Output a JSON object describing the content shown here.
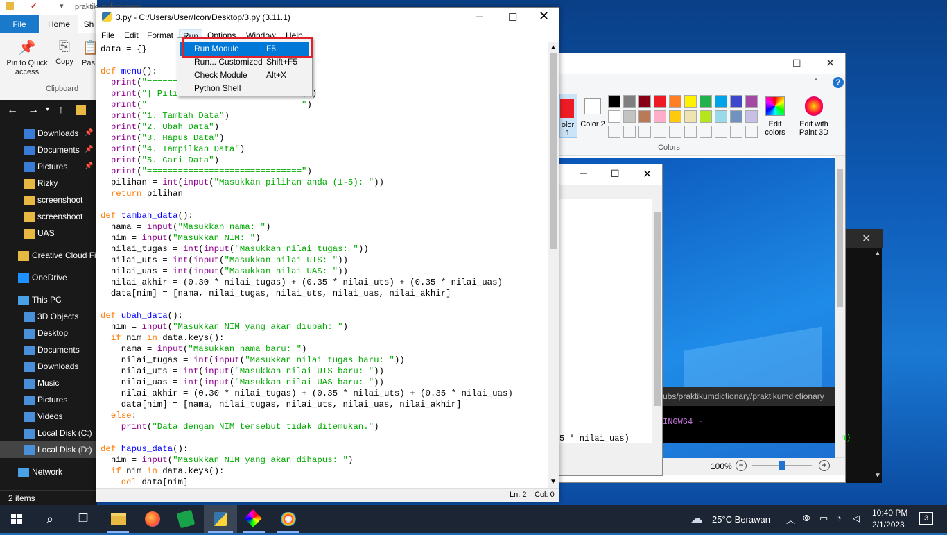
{
  "explorer": {
    "title": "praktikumdictionary",
    "tabs": [
      "File",
      "Home",
      "Sh"
    ],
    "ribbon": {
      "pin": "Pin to Quick access",
      "copy": "Copy",
      "paste": "Pas",
      "group": "Clipboard"
    },
    "quick_items": [
      {
        "label": "Downloads",
        "pinned": true
      },
      {
        "label": "Documents",
        "pinned": true
      },
      {
        "label": "Pictures",
        "pinned": true
      },
      {
        "label": "Rizky"
      },
      {
        "label": "screenshoot"
      },
      {
        "label": "screenshoot"
      },
      {
        "label": "UAS"
      }
    ],
    "creative_cloud": "Creative Cloud Fil",
    "onedrive": "OneDrive",
    "thispc": "This PC",
    "pc_items": [
      "3D Objects",
      "Desktop",
      "Documents",
      "Downloads",
      "Music",
      "Pictures",
      "Videos",
      "Local Disk (C:)",
      "Local Disk (D:)"
    ],
    "network": "Network",
    "status": "2 items"
  },
  "editor": {
    "title": "3.py - C:/Users/User/Icon/Desktop/3.py (3.11.1)",
    "menus": [
      "File",
      "Edit",
      "Format",
      "Run",
      "Options",
      "Window",
      "Help"
    ],
    "status_ln": "Ln: 2",
    "status_col": "Col: 0"
  },
  "run_menu": [
    {
      "label": "Run Module",
      "key": "F5",
      "selected": true
    },
    {
      "label": "Run... Customized",
      "key": "Shift+F5"
    },
    {
      "label": "Check Module",
      "key": "Alt+X"
    },
    {
      "label": "Python Shell",
      "key": ""
    }
  ],
  "paint": {
    "color1": "olor 1",
    "color2": "Color 2",
    "edit_colors": "Edit colors",
    "paint3d": "Edit with Paint 3D",
    "colors_group": "Colors",
    "zoom": "100%",
    "palette_row1": [
      "#000000",
      "#7f7f7f",
      "#880015",
      "#ed1c24",
      "#ff7f27",
      "#fff200",
      "#22b14c",
      "#00a2e8",
      "#3f48cc",
      "#a349a4"
    ],
    "palette_row2": [
      "#ffffff",
      "#c3c3c3",
      "#b97a57",
      "#ffaec9",
      "#ffc90e",
      "#efe4b0",
      "#b5e61d",
      "#99d9ea",
      "#7092be",
      "#c8bfe7"
    ]
  },
  "console": {
    "path": "ubs/praktikumdictionary/praktikumdictionary",
    "prompt": "INGW64 ~",
    "frag": "5 * nilai_uas)",
    "frag2": "n)"
  },
  "taskbar": {
    "weather": "25°C  Berawan",
    "time": "10:40 PM",
    "date": "2/1/2023",
    "notif": "3"
  }
}
